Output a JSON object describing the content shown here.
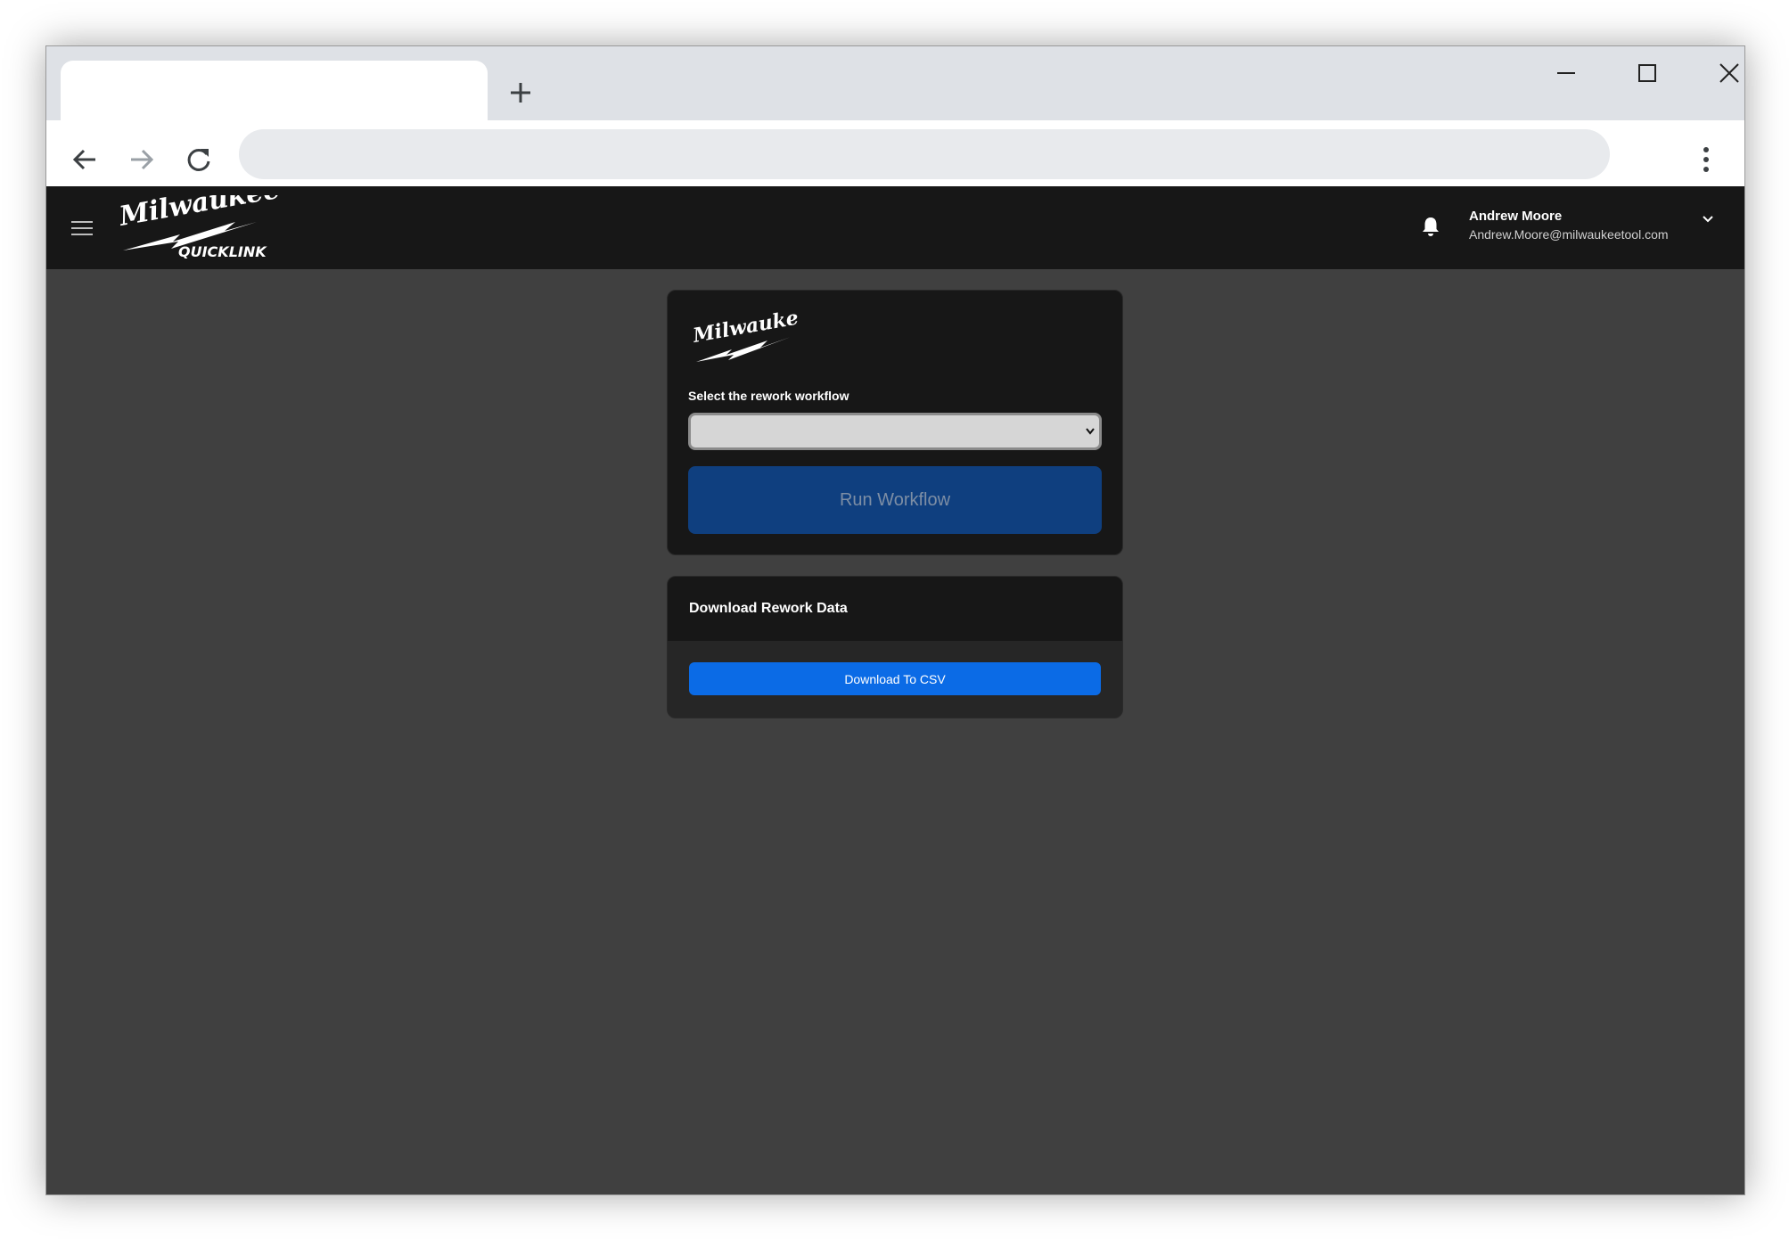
{
  "browser": {
    "tab_title": "",
    "address": "",
    "icons": {
      "new_tab": "plus-icon",
      "minimize": "minimize-icon",
      "maximize": "maximize-icon",
      "close": "close-icon",
      "back": "arrow-left-icon",
      "forward": "arrow-right-icon",
      "reload": "reload-icon",
      "menu": "vertical-dots-icon"
    }
  },
  "header": {
    "brand": "Milwaukee",
    "product": "QUICKLINK",
    "user_name": "Andrew Moore",
    "user_email": "Andrew.Moore@milwaukeetool.com",
    "icons": {
      "menu": "hamburger-icon",
      "notifications": "bell-icon",
      "user_menu": "chevron-down-icon"
    }
  },
  "workflow_card": {
    "brand": "Milwaukee",
    "select_label": "Select the rework workflow",
    "selected_value": "",
    "run_label": "Run Workflow"
  },
  "download_card": {
    "title": "Download Rework Data",
    "button_label": "Download To CSV"
  },
  "colors": {
    "header_bg": "#171717",
    "page_bg": "#404040",
    "run_button": "#0f3f7f",
    "csv_button": "#0b6be6"
  }
}
